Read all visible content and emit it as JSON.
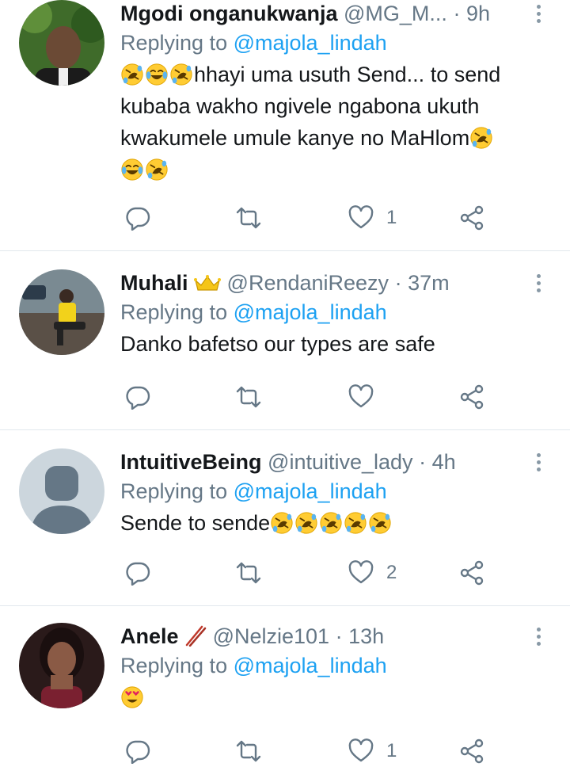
{
  "tweets": [
    {
      "name": "Mgodi onganukwanja",
      "handle": "@MG_M...",
      "time": "9h",
      "reply_prefix": "Replying to",
      "reply_to": "@majola_lindah",
      "text_lines": [
        "hhayi uma usuth Send... to send",
        "kubaba wakho ngivele ngabona ukuth",
        "kwakumele umule kanye no MaHlom"
      ],
      "like_count": "1",
      "retweet_count": "",
      "reply_count": ""
    },
    {
      "name": "Muhali",
      "handle": "@RendaniReezy",
      "time": "37m",
      "reply_prefix": "Replying to",
      "reply_to": "@majola_lindah",
      "text_lines": [
        "Danko bafetso our types are safe"
      ],
      "like_count": "",
      "retweet_count": "",
      "reply_count": ""
    },
    {
      "name": "IntuitiveBeing",
      "handle": "@intuitive_lady",
      "time": "4h",
      "reply_prefix": "Replying to",
      "reply_to": "@majola_lindah",
      "text_lines": [
        "Sende to sende"
      ],
      "like_count": "2",
      "retweet_count": "",
      "reply_count": ""
    },
    {
      "name": "Anele",
      "handle": "@Nelzie101",
      "time": "13h",
      "reply_prefix": "Replying to",
      "reply_to": "@majola_lindah",
      "text_lines": [
        ""
      ],
      "like_count": "1",
      "retweet_count": "",
      "reply_count": ""
    }
  ],
  "separator": "·",
  "icons": {
    "reply": "comment-icon",
    "retweet": "retweet-icon",
    "like": "heart-icon",
    "share": "share-icon",
    "more": "more-vertical-icon",
    "emoji_laugh": "rolling-on-floor-laughing-emoji",
    "emoji_joy": "face-with-tears-of-joy-emoji",
    "emoji_heart_eyes": "heart-eyes-emoji",
    "crown": "crown-icon",
    "chopsticks": "chopsticks-icon"
  },
  "colors": {
    "link": "#1da1f2",
    "secondary": "#657786",
    "divider": "#e1e8ed"
  }
}
